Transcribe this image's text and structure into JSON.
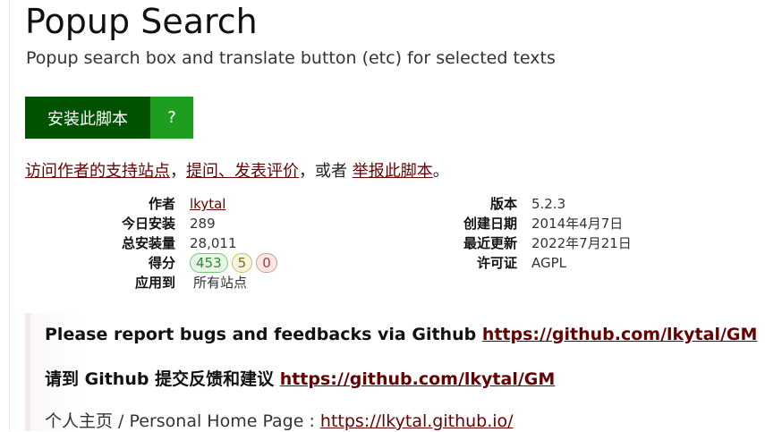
{
  "script": {
    "title": "Popup Search",
    "description": "Popup search box and translate button (etc) for selected texts"
  },
  "install": {
    "button_label": "安装此脚本",
    "help_label": "?"
  },
  "links": {
    "support_link": "访问作者的支持站点",
    "sep1": "，",
    "feedback_link": "提问、发表评价",
    "sep2": "，或者 ",
    "report_link": "举报此脚本",
    "end": "。"
  },
  "meta": {
    "author_label": "作者",
    "author_value": "lkytal",
    "daily_installs_label": "今日安装",
    "daily_installs_value": "289",
    "total_installs_label": "总安装量",
    "total_installs_value": "28,011",
    "ratings_label": "得分",
    "ratings_good": "453",
    "ratings_ok": "5",
    "ratings_bad": "0",
    "applies_label": "应用到",
    "applies_value": "所有站点",
    "version_label": "版本",
    "version_value": "5.2.3",
    "created_label": "创建日期",
    "created_value": "2014年4月7日",
    "updated_label": "最近更新",
    "updated_value": "2022年7月21日",
    "license_label": "许可证",
    "license_value": "AGPL"
  },
  "description_block": {
    "line1_text": "Please report bugs and feedbacks via Github ",
    "line1_link": "https://github.com/lkytal/GM",
    "line2_text": "请到 Github 提交反馈和建议 ",
    "line2_link": "https://github.com/lkytal/GM",
    "line3_text": "个人主页 / Personal Home Page : ",
    "line3_link": "https://lkytal.github.io/"
  }
}
